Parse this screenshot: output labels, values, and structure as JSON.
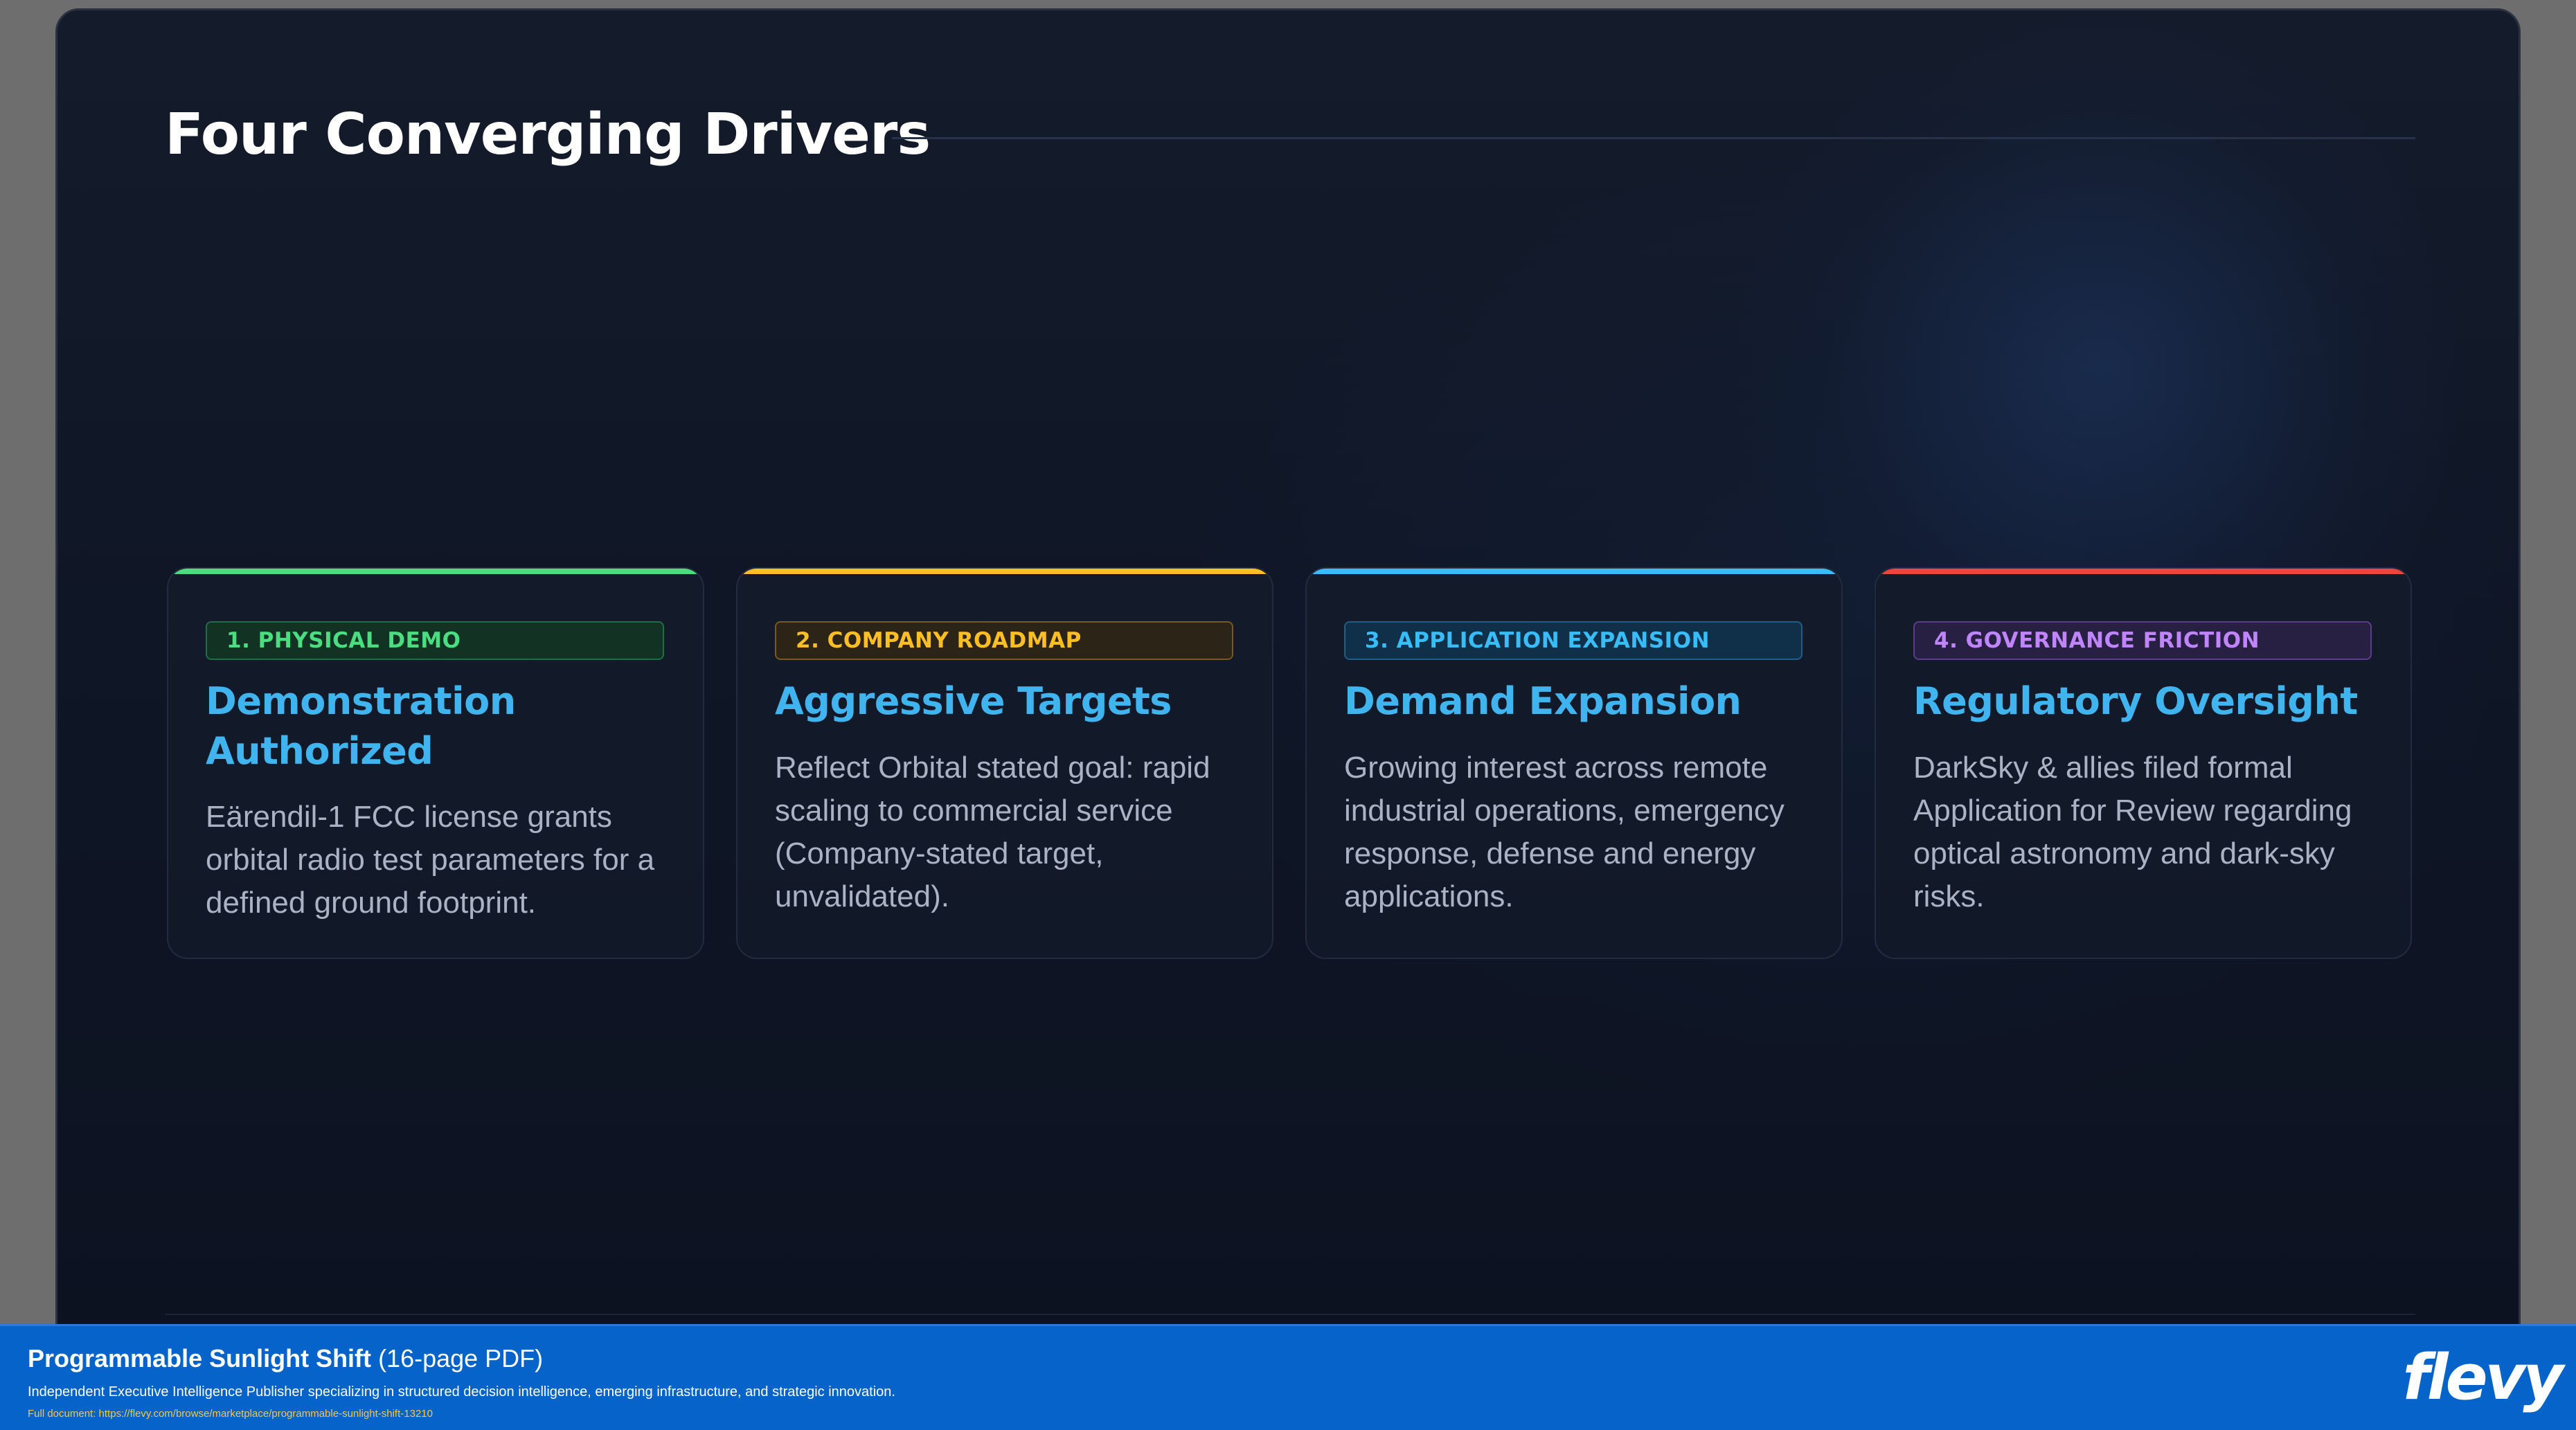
{
  "slide": {
    "title": "Four Converging Drivers"
  },
  "cards": [
    {
      "badge": "1. PHYSICAL DEMO",
      "title": "Demonstration Authorized",
      "body": "Eärendil-1 FCC license grants orbital radio test parameters for a defined ground footprint.",
      "accent": "#4ade80"
    },
    {
      "badge": "2. COMPANY ROADMAP",
      "title": "Aggressive Targets",
      "body": "Reflect Orbital stated goal: rapid scaling to commercial service (Company-stated target, unvalidated).",
      "accent": "#fbbf24"
    },
    {
      "badge": "3. APPLICATION EXPANSION",
      "title": "Demand Expansion",
      "body": "Growing interest across remote industrial operations, emergency response, defense and energy applications.",
      "accent": "#38bdf8"
    },
    {
      "badge": "4. GOVERNANCE FRICTION",
      "title": "Regulatory Oversight",
      "body": "DarkSky & allies filed formal Application for Review regarding optical astronomy and dark-sky risks.",
      "accent": "#ef4444"
    }
  ],
  "footer": {
    "doc_title": "Programmable Sunlight Shift",
    "doc_pages": "(16-page PDF)",
    "description": "Independent Executive Intelligence Publisher specializing in structured decision intelligence, emerging infrastructure, and strategic innovation.",
    "link": "Full document: https://flevy.com/browse/marketplace/programmable-sunlight-shift-13210",
    "brand": "flevy"
  },
  "colors": {
    "footer_bg": "#0563c9",
    "title_accent": "#3fb4ee",
    "slide_bg": "#0f1626"
  }
}
